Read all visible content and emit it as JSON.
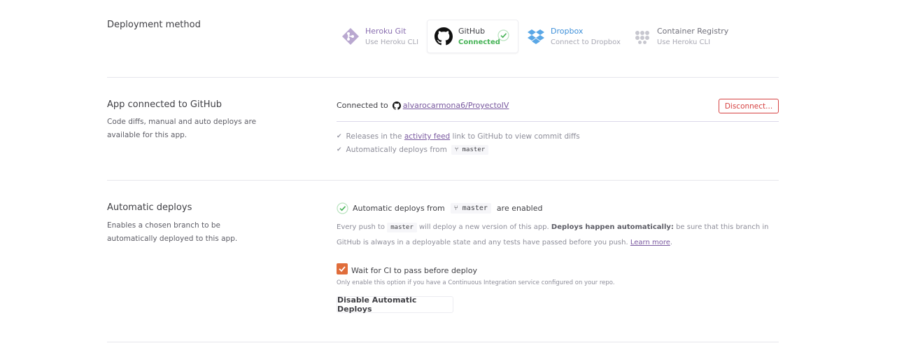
{
  "deployment": {
    "title": "Deployment method",
    "methods": [
      {
        "name": "Heroku Git",
        "sub": "Use Heroku CLI",
        "icon": "heroku-git-icon"
      },
      {
        "name": "GitHub",
        "sub": "Connected",
        "icon": "github-icon"
      },
      {
        "name": "Dropbox",
        "sub": "Connect to Dropbox",
        "icon": "dropbox-icon"
      },
      {
        "name": "Container Registry",
        "sub": "Use Heroku CLI",
        "icon": "container-registry-icon"
      }
    ]
  },
  "connected": {
    "title": "App connected to GitHub",
    "desc": "Code diffs, manual and auto deploys are available for this app.",
    "connected_to": "Connected to",
    "repo": "alvarocarmona6/ProyectoIV",
    "disconnect": "Disconnect...",
    "release_pre": "Releases in the",
    "release_link": "activity feed",
    "release_post": "link to GitHub to view commit diffs",
    "auto_pre": "Automatically deploys from",
    "branch": "master"
  },
  "auto": {
    "title": "Automatic deploys",
    "desc": "Enables a chosen branch to be automatically deployed to this app.",
    "status_pre": "Automatic deploys from",
    "branch": "master",
    "status_post": "are enabled",
    "info_1": "Every push to",
    "info_branch": "master",
    "info_2": "will deploy a new version of this app.",
    "info_bold": "Deploys happen automatically:",
    "info_3": "be sure that this branch in GitHub is always in a deployable state and any tests have passed before you push.",
    "learn_more": "Learn more",
    "ci_label": "Wait for CI to pass before deploy",
    "ci_note": "Only enable this option if you have a Continuous Integration service configured on your repo.",
    "ci_checked": true,
    "disable_button": "Disable Automatic Deploys"
  },
  "colors": {
    "purple": "#79589f",
    "green": "#46b356",
    "blue": "#3d8fd9",
    "red": "#d64242",
    "orange": "#e06d3b"
  }
}
